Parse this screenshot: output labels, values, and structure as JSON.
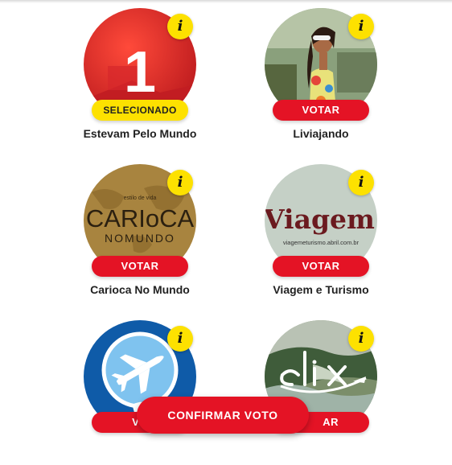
{
  "colors": {
    "accent_red": "#e41325",
    "badge_yellow": "#fde100"
  },
  "info_label": "i",
  "candidates": [
    {
      "name": "Estevam Pelo Mundo",
      "button_label": "SELECIONADO",
      "selected": true,
      "image_text": "1"
    },
    {
      "name": "Liviajando",
      "button_label": "VOTAR",
      "selected": false
    },
    {
      "name": "Carioca No Mundo",
      "button_label": "VOTAR",
      "selected": false,
      "image_text": {
        "top": "estilo de vida",
        "main": "CARIoCA",
        "sub": "NOMUNDO"
      }
    },
    {
      "name": "Viagem e Turismo",
      "button_label": "VOTAR",
      "selected": false,
      "image_text": {
        "main": "Viagem",
        "sub": "viagemeturismo.abril.com.br"
      }
    },
    {
      "name": "",
      "button_label": "VO",
      "selected": false
    },
    {
      "name": "",
      "button_label": "AR",
      "selected": false
    }
  ],
  "confirm_label": "CONFIRMAR VOTO"
}
